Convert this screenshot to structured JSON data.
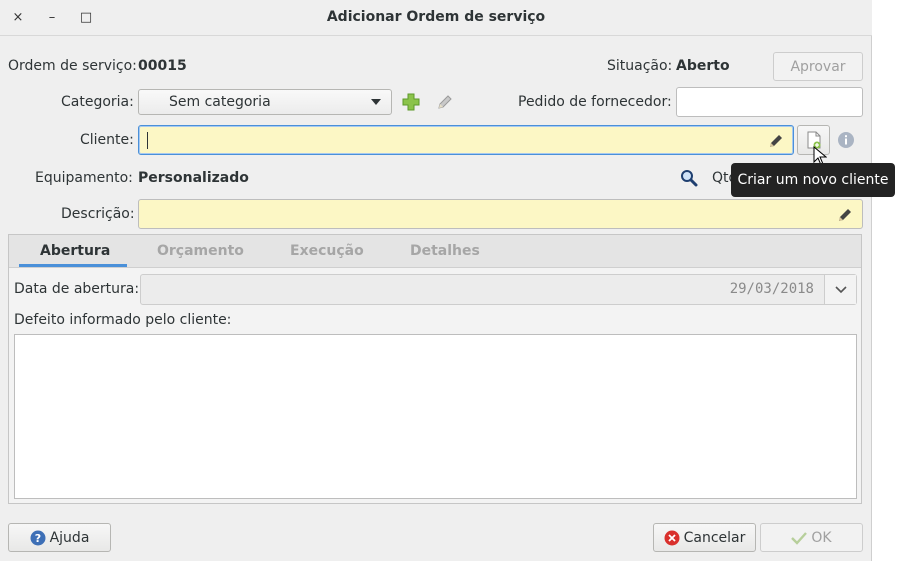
{
  "window": {
    "title": "Adicionar Ordem de serviço",
    "close_glyph": "×",
    "minimize_glyph": "–",
    "maximize_glyph": "□"
  },
  "header": {
    "order_label": "Ordem de serviço:",
    "order_number": "00015",
    "status_label": "Situação:",
    "status_value": "Aberto",
    "approve_label": "Aprovar"
  },
  "form": {
    "category_label": "Categoria:",
    "category_value": "Sem categoria",
    "supplier_order_label": "Pedido de fornecedor:",
    "supplier_order_value": "",
    "client_label": "Cliente:",
    "client_value": "",
    "equipment_label": "Equipamento:",
    "equipment_value": "Personalizado",
    "qty_label": "Qtd",
    "description_label": "Descrição:",
    "description_value": ""
  },
  "tooltip": {
    "text": "Criar um novo cliente"
  },
  "tabs": {
    "items": [
      {
        "label": "Abertura",
        "active": true
      },
      {
        "label": "Orçamento",
        "active": false
      },
      {
        "label": "Execução",
        "active": false
      },
      {
        "label": "Detalhes",
        "active": false
      }
    ],
    "opening": {
      "date_label": "Data de abertura:",
      "date_value": "29/03/2018",
      "defect_label": "Defeito informado pelo cliente:",
      "defect_value": ""
    }
  },
  "footer": {
    "help_label": "Ajuda",
    "cancel_label": "Cancelar",
    "ok_label": "OK"
  },
  "colors": {
    "accent": "#4a90d9",
    "mandatory_field": "#fcf7c5",
    "add_green": "#8bc34a",
    "cancel_red": "#d9302c",
    "help_blue": "#3d6fb6"
  },
  "icons": [
    "close-icon",
    "minimize-icon",
    "maximize-icon",
    "add-icon",
    "edit-icon",
    "pencil-icon",
    "new-document-icon",
    "info-icon",
    "search-icon",
    "chevron-down-icon",
    "help-icon",
    "cancel-icon",
    "check-icon",
    "mouse-cursor-icon"
  ]
}
